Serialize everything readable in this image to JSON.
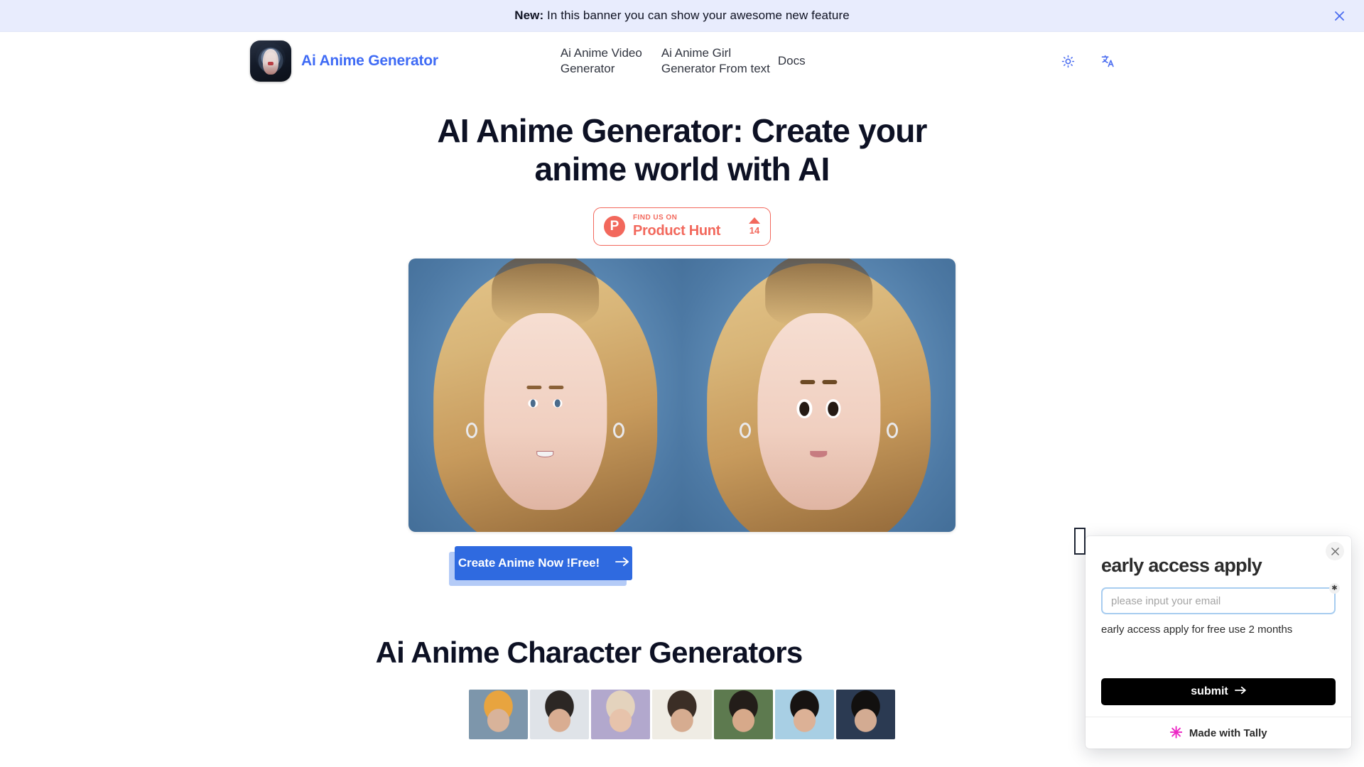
{
  "banner": {
    "prefix": "New:",
    "text": " In this banner you can show your awesome new feature",
    "close_icon": "close-icon",
    "bg_color": "#e8ecfd",
    "accent_color": "#4a6cf0"
  },
  "header": {
    "brand_name": "Ai Anime Generator",
    "brand_color": "#3f6bf5",
    "nav": [
      {
        "label": "Ai Anime Video Generator"
      },
      {
        "label": "Ai Anime Girl Generator From text"
      },
      {
        "label": "Docs"
      }
    ],
    "actions": [
      {
        "icon": "sun-icon",
        "name": "theme-toggle"
      },
      {
        "icon": "translate-icon",
        "name": "language-toggle"
      }
    ]
  },
  "hero": {
    "title": "AI Anime Generator: Create your anime world with AI",
    "product_hunt": {
      "kicker": "FIND US ON",
      "name": "Product Hunt",
      "votes": "14",
      "color": "#f2685c"
    },
    "cta": {
      "label": "Create Anime Now !Free!",
      "arrow": "arrow-right-icon",
      "bg_color": "#2f6ae0",
      "shadow_color": "#b4cbf7"
    }
  },
  "section": {
    "title": "Ai Anime Character Generators",
    "thumbnails": [
      {
        "name": "character-thumb-1",
        "colors": [
          "#7d96ab",
          "#e8a43f",
          "#d8b39a"
        ]
      },
      {
        "name": "character-thumb-2",
        "colors": [
          "#dfe3e8",
          "#2c2724",
          "#d9ad92"
        ]
      },
      {
        "name": "character-thumb-3",
        "colors": [
          "#b2a8cd",
          "#e4d3bd",
          "#e7c3ab"
        ]
      },
      {
        "name": "character-thumb-4",
        "colors": [
          "#efece4",
          "#3b2e26",
          "#d6ac90"
        ]
      },
      {
        "name": "character-thumb-5",
        "colors": [
          "#5d7a4f",
          "#231d19",
          "#d7a98a"
        ]
      },
      {
        "name": "character-thumb-6",
        "colors": [
          "#a8cfe4",
          "#171311",
          "#dcb196"
        ]
      },
      {
        "name": "character-thumb-7",
        "colors": [
          "#2b3a52",
          "#12100f",
          "#d3ab92"
        ]
      }
    ]
  },
  "tally": {
    "title": "early access apply",
    "email_placeholder": "please input your email",
    "email_value": "",
    "required_marker": "✱",
    "help_text": "early access apply for free use 2 months",
    "submit_label": "submit",
    "submit_arrow": "arrow-right-icon",
    "footer_label": "Made with Tally",
    "footer_icon": "asterisk-icon",
    "footer_icon_color": "#ec26c4",
    "close_icon": "close-icon"
  }
}
